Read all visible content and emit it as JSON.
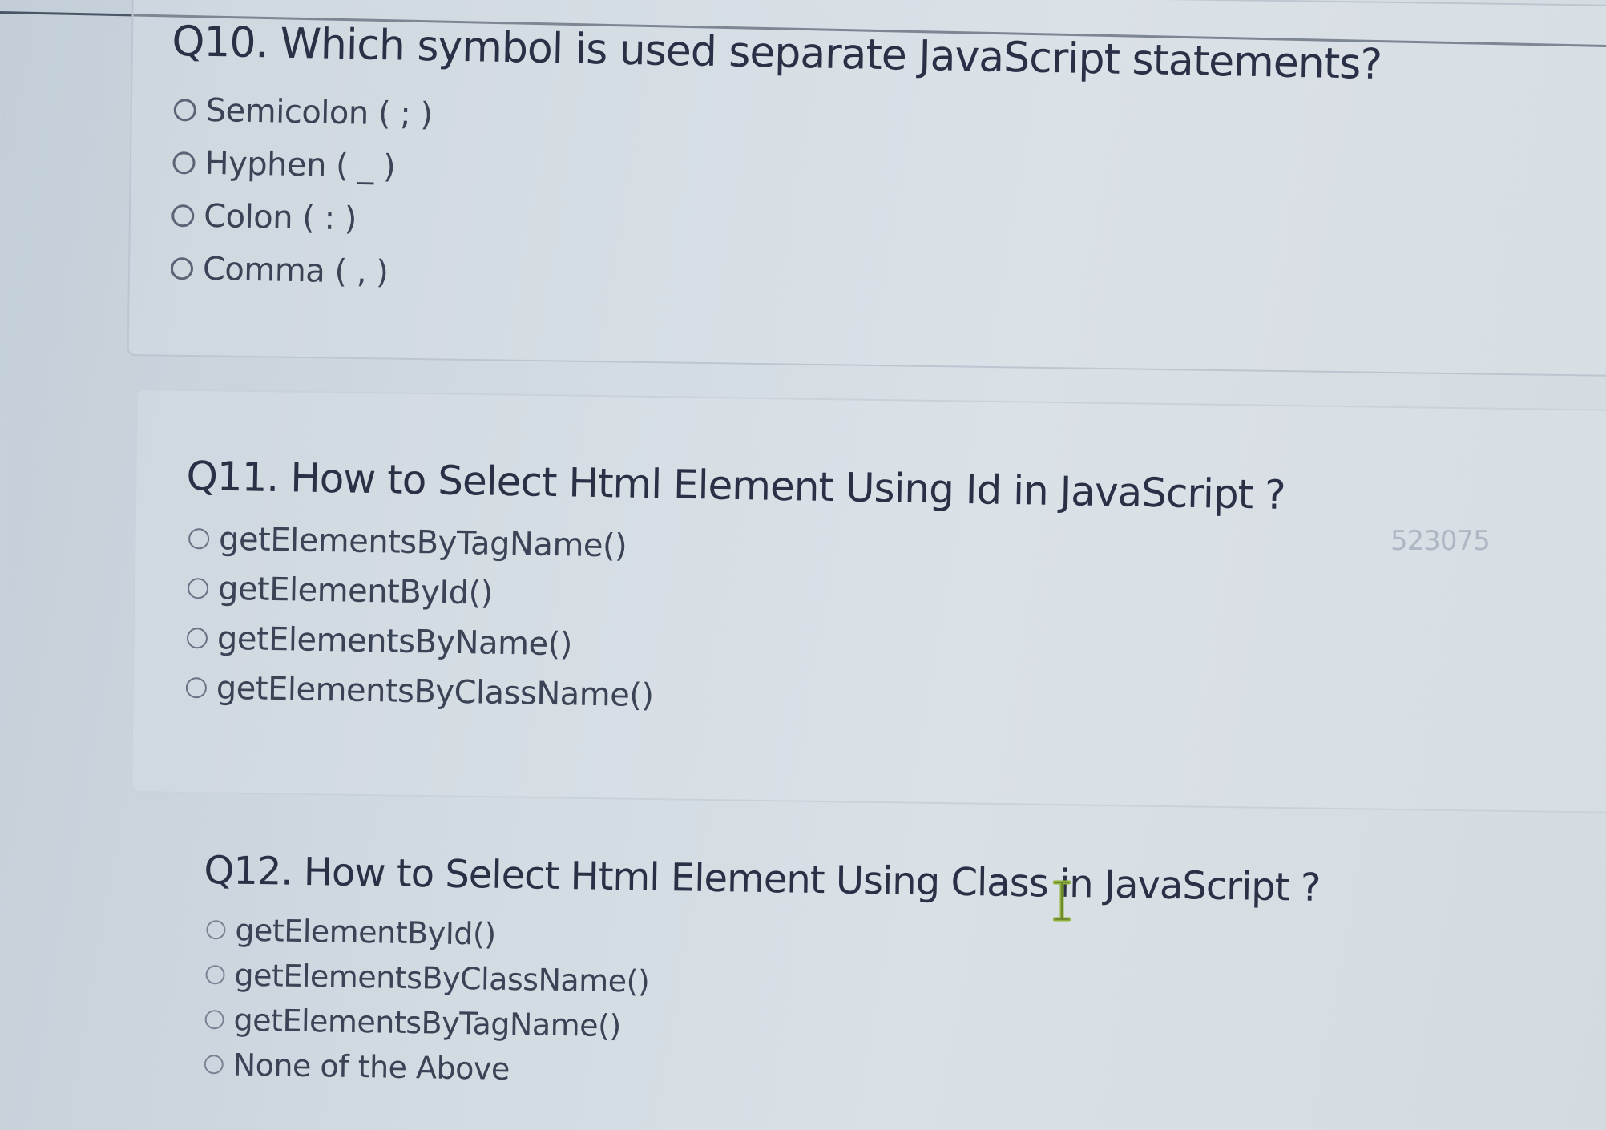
{
  "quiz": {
    "watermark_id": "523075",
    "questions": [
      {
        "number": "Q10.",
        "title": "Q10. Which symbol is used separate JavaScript statements?",
        "options": [
          {
            "label": "Semicolon ( ; )",
            "selected": false
          },
          {
            "label": "Hyphen ( _ )",
            "selected": false
          },
          {
            "label": "Colon ( : )",
            "selected": false
          },
          {
            "label": "Comma ( , )",
            "selected": false
          }
        ]
      },
      {
        "number": "Q11.",
        "title": "Q11. How to Select Html Element Using Id in JavaScript ?",
        "options": [
          {
            "label": "getElementsByTagName()",
            "selected": false
          },
          {
            "label": "getElementById()",
            "selected": false
          },
          {
            "label": "getElementsByName()",
            "selected": false
          },
          {
            "label": "getElementsByClassName()",
            "selected": false
          }
        ]
      },
      {
        "number": "Q12.",
        "title": "Q12. How to Select Html Element Using Class in JavaScript ?",
        "options": [
          {
            "label": "getElementById()",
            "selected": false
          },
          {
            "label": "getElementsByClassName()",
            "selected": false
          },
          {
            "label": "getElementsByTagName()",
            "selected": false
          },
          {
            "label": "None of the Above",
            "selected": false
          }
        ]
      }
    ]
  },
  "cursor": {
    "icon": "text-cursor-icon",
    "color": "#8fb23a"
  },
  "colors": {
    "text": "#2a3147",
    "radio_border": "#5c6577",
    "background": "#d2dbe2"
  }
}
